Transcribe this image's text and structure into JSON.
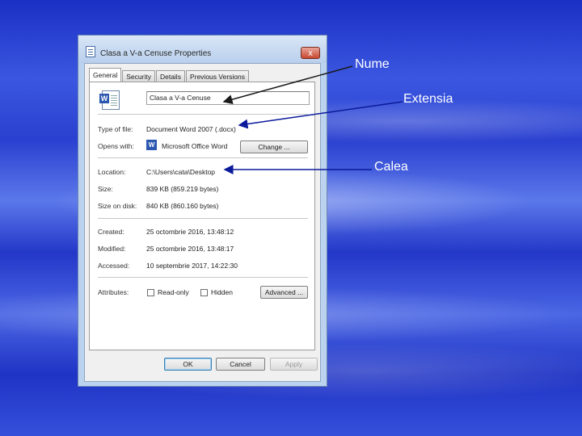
{
  "annotations": {
    "name": "Nume",
    "extension": "Extensia",
    "path": "Calea"
  },
  "dialog": {
    "title": "Clasa a V-a Cenuse Properties",
    "close_glyph": "x",
    "tabs": [
      {
        "label": "General",
        "active": true
      },
      {
        "label": "Security",
        "active": false
      },
      {
        "label": "Details",
        "active": false
      },
      {
        "label": "Previous Versions",
        "active": false
      }
    ],
    "file_name": "Clasa a V-a Cenuse",
    "type_of_file": {
      "label": "Type of file:",
      "value": "Document Word 2007 (.docx)"
    },
    "opens_with": {
      "label": "Opens with:",
      "value": "Microsoft Office Word",
      "button": "Change ..."
    },
    "location": {
      "label": "Location:",
      "value": "C:\\Users\\cata\\Desktop"
    },
    "size": {
      "label": "Size:",
      "value": "839 KB (859.219 bytes)"
    },
    "size_on_disk": {
      "label": "Size on disk:",
      "value": "840 KB (860.160 bytes)"
    },
    "created": {
      "label": "Created:",
      "value": "25 octombrie 2016, 13:48:12"
    },
    "modified": {
      "label": "Modified:",
      "value": "25 octombrie 2016, 13:48:17"
    },
    "accessed": {
      "label": "Accessed:",
      "value": "10 septembrie 2017, 14:22:30"
    },
    "attributes": {
      "label": "Attributes:",
      "read_only": {
        "label": "Read-only",
        "checked": false
      },
      "hidden": {
        "label": "Hidden",
        "checked": false
      },
      "advanced_button": "Advanced ..."
    },
    "buttons": {
      "ok": "OK",
      "cancel": "Cancel",
      "apply": "Apply"
    }
  },
  "colors": {
    "arrow": "#1a1a1a",
    "arrow_blue": "#0a1a9a"
  }
}
